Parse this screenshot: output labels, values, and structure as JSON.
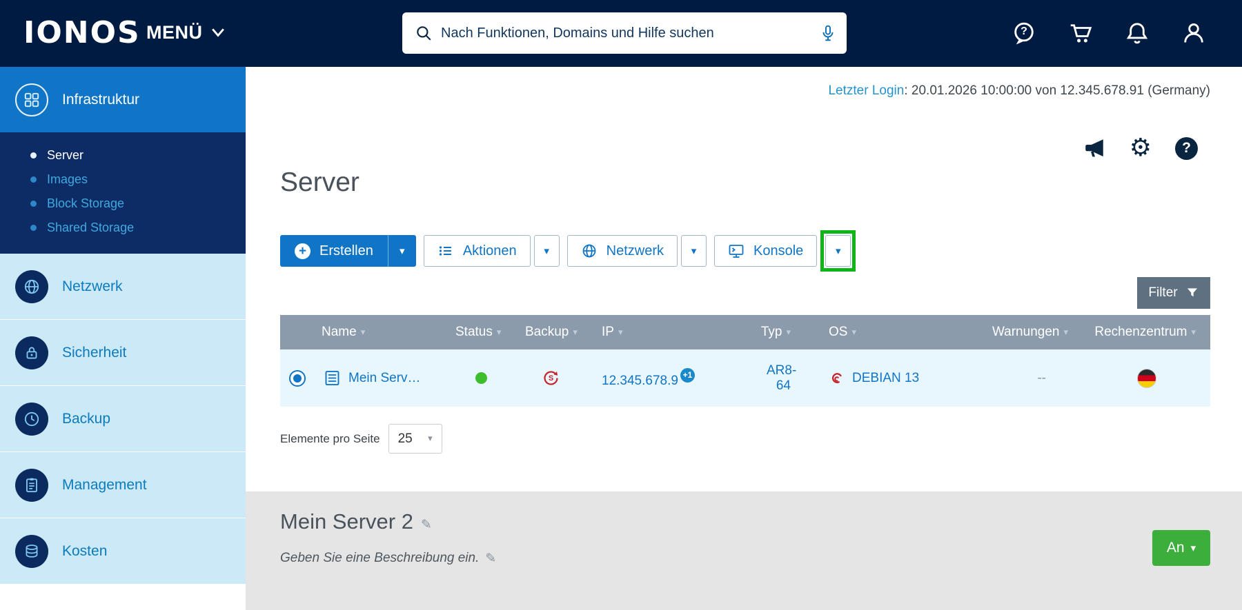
{
  "colors": {
    "header_bg": "#001B41",
    "primary_blue": "#1075C6",
    "sidebar_item_bg": "#CBE9F7",
    "submenu_bg": "#0D2B64",
    "sidebar_link_blue": "#3FA9E0",
    "table_header_bg": "#8C9BAC",
    "row_bg": "#E8F6FD",
    "status_green": "#3FBE2D",
    "power_green": "#3CAE3C",
    "annotation_green": "#0FB419",
    "filter_gray": "#5F7081",
    "panel_gray": "#E5E5E5",
    "debian_red": "#C4262B"
  },
  "icons": {
    "sort": "▾",
    "caret": "▾",
    "gear": "⚙",
    "pencil": "✎",
    "question": "?",
    "plus": "+",
    "backup_glyph": "S"
  },
  "header": {
    "logo": "IONOS",
    "menu_label": "MENÜ",
    "search_placeholder": "Nach Funktionen, Domains und Hilfe suchen"
  },
  "sidebar": {
    "items": [
      {
        "label": "Infrastruktur"
      },
      {
        "label": "Netzwerk"
      },
      {
        "label": "Sicherheit"
      },
      {
        "label": "Backup"
      },
      {
        "label": "Management"
      },
      {
        "label": "Kosten"
      }
    ],
    "infrastruktur_sub": [
      {
        "label": "Server"
      },
      {
        "label": "Images"
      },
      {
        "label": "Block Storage"
      },
      {
        "label": "Shared Storage"
      }
    ]
  },
  "main": {
    "last_login_label": "Letzter Login",
    "last_login_rest": ": 20.01.2026 10:00:00 von 12.345.678.91 (Germany)",
    "page_title": "Server",
    "toolbar": {
      "create_label": "Erstellen",
      "actions_label": "Aktionen",
      "network_label": "Netzwerk",
      "console_label": "Konsole",
      "filter_label": "Filter"
    },
    "table": {
      "headers": [
        "Name",
        "Status",
        "Backup",
        "IP",
        "Typ",
        "OS",
        "Warnungen",
        "Rechenzentrum"
      ],
      "row": {
        "name": "Mein Serv…",
        "ip": "12.345.678.9",
        "ip_badge": "+1",
        "typ": "AR8-64",
        "os": "DEBIAN 13",
        "warnings": "--"
      }
    },
    "pagination": {
      "label": "Elemente pro Seite",
      "value": "25"
    },
    "detail": {
      "title": "Mein Server 2",
      "description": "Geben Sie eine Beschreibung ein.",
      "power_label": "An"
    }
  }
}
